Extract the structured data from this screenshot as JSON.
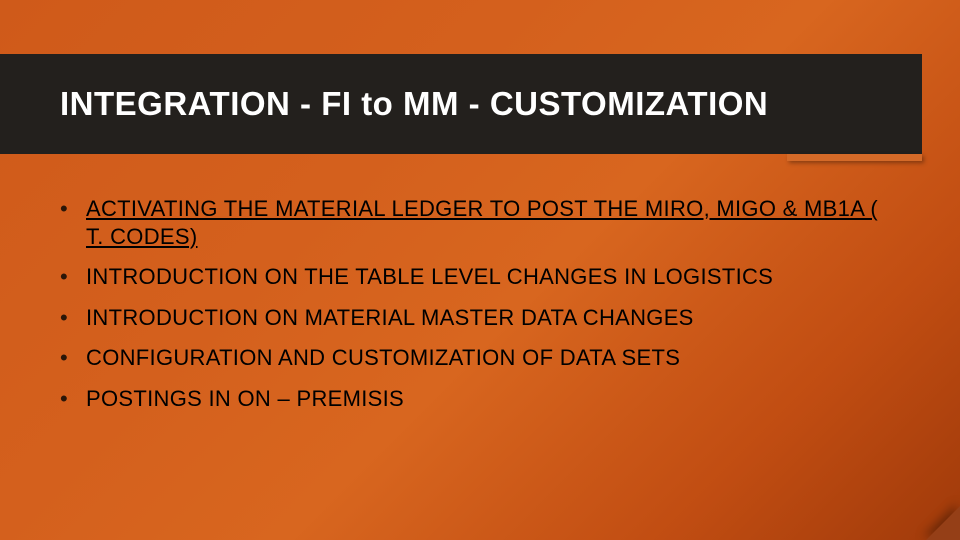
{
  "title": "INTEGRATION  - FI to MM -  CUSTOMIZATION",
  "bullets": [
    {
      "text": "ACTIVATING THE MATERIAL LEDGER TO POST THE MIRO, MIGO & MB1A ( T. CODES)",
      "underline": true
    },
    {
      "text": "INTRODUCTION ON THE TABLE LEVEL CHANGES IN LOGISTICS",
      "underline": false
    },
    {
      "text": "INTRODUCTION ON MATERIAL MASTER DATA CHANGES",
      "underline": false
    },
    {
      "text": "CONFIGURATION AND CUSTOMIZATION OF DATA SETS",
      "underline": false
    },
    {
      "text": "POSTINGS IN ON – PREMISIS",
      "underline": false
    }
  ]
}
